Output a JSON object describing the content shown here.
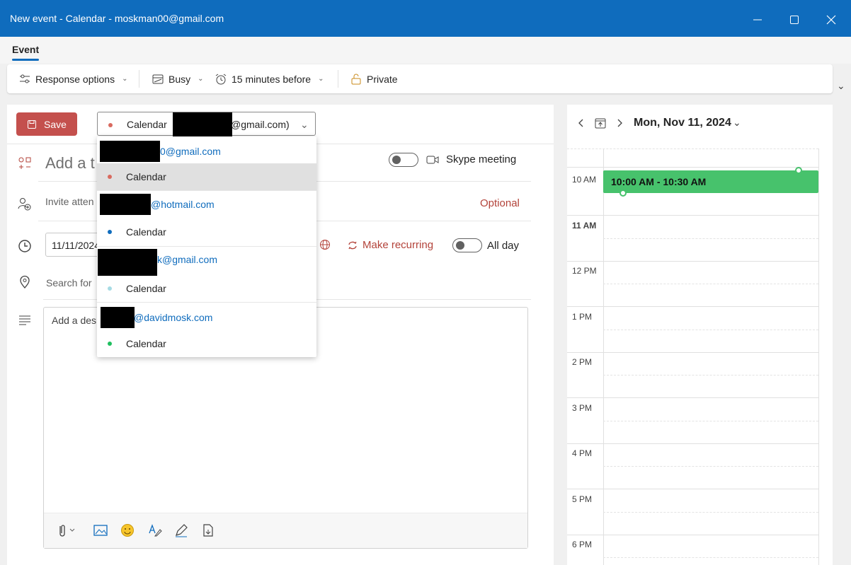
{
  "window": {
    "title": "New event - Calendar - moskman00@gmail.com"
  },
  "ribbon": {
    "tab": "Event",
    "items": {
      "response_options": "Response options",
      "busy": "Busy",
      "reminder": "15 minutes before",
      "private": "Private"
    }
  },
  "form": {
    "save_label": "Save",
    "calendar_select": {
      "label": "Calendar",
      "suffix": "@gmail.com)"
    },
    "title_placeholder": "Add a t",
    "skype_label": "Skype meeting",
    "invite_placeholder": "Invite atten",
    "optional_label": "Optional",
    "start_date": "11/11/2024",
    "make_recurring": "Make recurring",
    "all_day": "All day",
    "location_placeholder": "Search for",
    "description_placeholder": "Add a des"
  },
  "dropdown": {
    "groups": [
      {
        "account": "0@gmail.com",
        "calendar": "Calendar",
        "dot_color": "#d96a5f",
        "selected": true
      },
      {
        "account": "@hotmail.com",
        "calendar": "Calendar",
        "dot_color": "#0f6cbd",
        "selected": false
      },
      {
        "account": "k@gmail.com",
        "calendar": "Calendar",
        "dot_color": "#a6dbe4",
        "selected": false
      },
      {
        "account": "@davidmosk.com",
        "calendar": "Calendar",
        "dot_color": "#1fbf5f",
        "selected": false
      }
    ]
  },
  "calendar_view": {
    "date_title": "Mon, Nov 11, 2024",
    "hours": [
      "10 AM",
      "11 AM",
      "12 PM",
      "1 PM",
      "2 PM",
      "3 PM",
      "4 PM",
      "5 PM",
      "6 PM"
    ],
    "event_time": "10:00 AM - 10:30 AM",
    "event_color": "#47c26c"
  },
  "colors": {
    "titlebar": "#0f6cbd",
    "save_button": "#c4504d",
    "accent_red": "#b3433a"
  }
}
